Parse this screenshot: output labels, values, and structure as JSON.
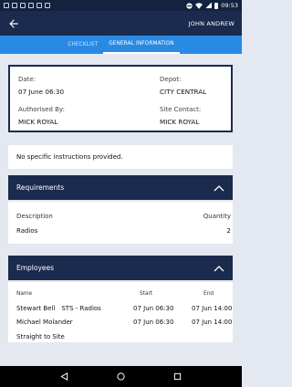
{
  "status_bar": {
    "time": "09:53",
    "icons": [
      "image-icon",
      "image-icon",
      "download-icon",
      "image-icon",
      "download-icon",
      "document-icon",
      "do-not-disturb-icon",
      "wifi-icon",
      "signal-icon",
      "battery-icon"
    ]
  },
  "header": {
    "back_icon": "arrow-left-icon",
    "user_name": "JOHN ANDREW"
  },
  "tabs": [
    {
      "label": "CHECKLIST",
      "active": false
    },
    {
      "label": "GENERAL INFORMATION",
      "active": true
    }
  ],
  "info": {
    "date_label": "Date:",
    "date_value": "07 June 06:30",
    "depot_label": "Depot:",
    "depot_value": "CITY CENTRAL",
    "authorised_label": "Authorised By:",
    "authorised_value": "MICK ROYAL",
    "site_contact_label": "Site Contact:",
    "site_contact_value": "MICK ROYAL"
  },
  "instructions_text": "No specific instructions provided.",
  "requirements": {
    "title": "Requirements",
    "columns": [
      "Description",
      "Quantity"
    ],
    "rows": [
      {
        "description": "Radios",
        "quantity": "2"
      }
    ]
  },
  "employees": {
    "title": "Employees",
    "columns": [
      "Name",
      "Start",
      "End"
    ],
    "rows": [
      {
        "name": "Stewart Bell",
        "role": "STS - Radios",
        "start": "07 Jun 06:30",
        "end": "07 Jun 14:00"
      },
      {
        "name": "Michael Molander",
        "role": "Straight to Site",
        "start": "07 Jun 06:30",
        "end": "07 Jun 14:00"
      }
    ]
  },
  "colors": {
    "header_dark": "#1b2b4d",
    "tab_blue": "#2a8ae3",
    "background": "#e4e8f0"
  }
}
